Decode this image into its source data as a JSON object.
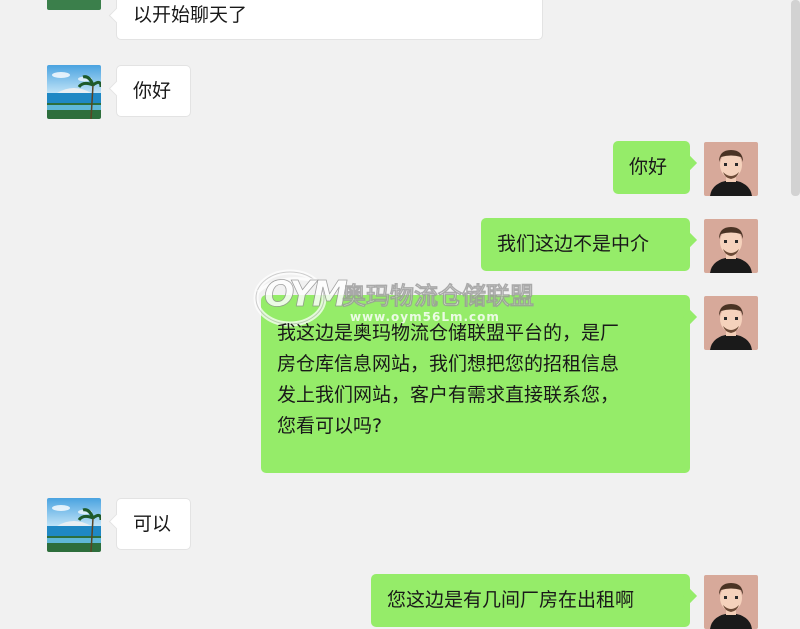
{
  "conversation": {
    "messages": [
      {
        "sender": "contact",
        "text": "以开始聊天了"
      },
      {
        "sender": "contact",
        "text": "你好"
      },
      {
        "sender": "me",
        "text": "你好"
      },
      {
        "sender": "me",
        "text": "我们这边不是中介"
      },
      {
        "sender": "me",
        "lines": [
          "我这边是奥玛物流仓储联盟平台的，是厂",
          "房仓库信息网站，我们想把您的招租信息",
          "发上我们网站，客户有需求直接联系您，",
          "您看可以吗?"
        ]
      },
      {
        "sender": "contact",
        "text": "可以"
      },
      {
        "sender": "me",
        "text": "您这边是有几间厂房在出租啊"
      }
    ]
  },
  "watermark": {
    "logo_text": "OYM",
    "title": "奥玛物流仓储联盟",
    "url": "www.oym56Lm.com"
  },
  "colors": {
    "background": "#f1f1f1",
    "incoming_bubble": "#ffffff",
    "outgoing_bubble": "#95ec69",
    "text": "#191919"
  },
  "icons": {
    "contact_avatar": "beach-avatar-icon",
    "user_avatar": "man-avatar-icon"
  }
}
